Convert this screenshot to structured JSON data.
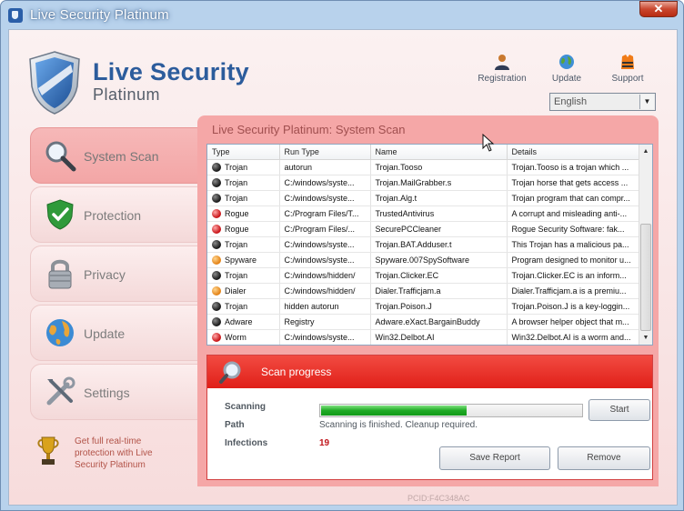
{
  "window": {
    "title": "Live Security Platinum",
    "close_label": "✕"
  },
  "logo": {
    "title": "Live Security",
    "subtitle": "Platinum"
  },
  "toolbar": {
    "registration_label": "Registration",
    "update_label": "Update",
    "support_label": "Support",
    "language_value": "English"
  },
  "nav": [
    {
      "label": "System Scan",
      "icon": "magnifier-icon",
      "active": true
    },
    {
      "label": "Protection",
      "icon": "shield-check-icon",
      "active": false
    },
    {
      "label": "Privacy",
      "icon": "padlock-icon",
      "active": false
    },
    {
      "label": "Update",
      "icon": "globe-icon",
      "active": false
    },
    {
      "label": "Settings",
      "icon": "tools-icon",
      "active": false
    }
  ],
  "promo": {
    "text": "Get full real-time protection with Live Security Platinum"
  },
  "panel": {
    "title": "Live Security Platinum: System Scan"
  },
  "table": {
    "headers": [
      "Type",
      "Run Type",
      "Name",
      "Details"
    ],
    "rows": [
      {
        "dot": "dark",
        "type": "Trojan",
        "run_type": "autorun",
        "name": "Trojan.Tooso",
        "details": "Trojan.Tooso is a trojan which ..."
      },
      {
        "dot": "dark",
        "type": "Trojan",
        "run_type": "C:/windows/syste...",
        "name": "Trojan.MailGrabber.s",
        "details": "Trojan horse that gets access ..."
      },
      {
        "dot": "dark",
        "type": "Trojan",
        "run_type": "C:/windows/syste...",
        "name": "Trojan.Alg.t",
        "details": "Trojan program that can compr..."
      },
      {
        "dot": "red",
        "type": "Rogue",
        "run_type": "C:/Program Files/T...",
        "name": "TrustedAntivirus",
        "details": "A corrupt and misleading anti-..."
      },
      {
        "dot": "red",
        "type": "Rogue",
        "run_type": "C:/Program Files/...",
        "name": "SecurePCCleaner",
        "details": "Rogue Security Software: fak..."
      },
      {
        "dot": "dark",
        "type": "Trojan",
        "run_type": "C:/windows/syste...",
        "name": "Trojan.BAT.Adduser.t",
        "details": "This Trojan has a malicious pa..."
      },
      {
        "dot": "orange",
        "type": "Spyware",
        "run_type": "C:/windows/syste...",
        "name": "Spyware.007SpySoftware",
        "details": "Program designed to monitor u..."
      },
      {
        "dot": "dark",
        "type": "Trojan",
        "run_type": "C:/windows/hidden/",
        "name": "Trojan.Clicker.EC",
        "details": "Trojan.Clicker.EC is an inform..."
      },
      {
        "dot": "orange",
        "type": "Dialer",
        "run_type": "C:/windows/hidden/",
        "name": "Dialer.Trafficjam.a",
        "details": "Dialer.Trafficjam.a is a premiu..."
      },
      {
        "dot": "dark",
        "type": "Trojan",
        "run_type": "hidden autorun",
        "name": "Trojan.Poison.J",
        "details": "Trojan.Poison.J is a key-loggin..."
      },
      {
        "dot": "dark",
        "type": "Adware",
        "run_type": "Registry",
        "name": "Adware.eXact.BargainBuddy",
        "details": "A browser helper object that m..."
      },
      {
        "dot": "red",
        "type": "Worm",
        "run_type": "C:/windows/syste...",
        "name": "Win32.Delbot.AI",
        "details": "Win32.Delbot.AI is a worm and..."
      }
    ]
  },
  "scan": {
    "title": "Scan progress",
    "scanning_label": "Scanning",
    "path_label": "Path",
    "path_value": "Scanning is finished. Cleanup required.",
    "infections_label": "Infections",
    "infections_value": "19",
    "progress_fraction": 0.56,
    "start_label": "Start",
    "save_report_label": "Save Report",
    "remove_label": "Remove"
  },
  "footer": {
    "pcid": "PCID:F4C348AC"
  },
  "colors": {
    "accent_red": "#e0261f",
    "panel_pink": "#f5a7a7",
    "brand_blue": "#2c5c9c",
    "progress_green": "#1faa25"
  }
}
